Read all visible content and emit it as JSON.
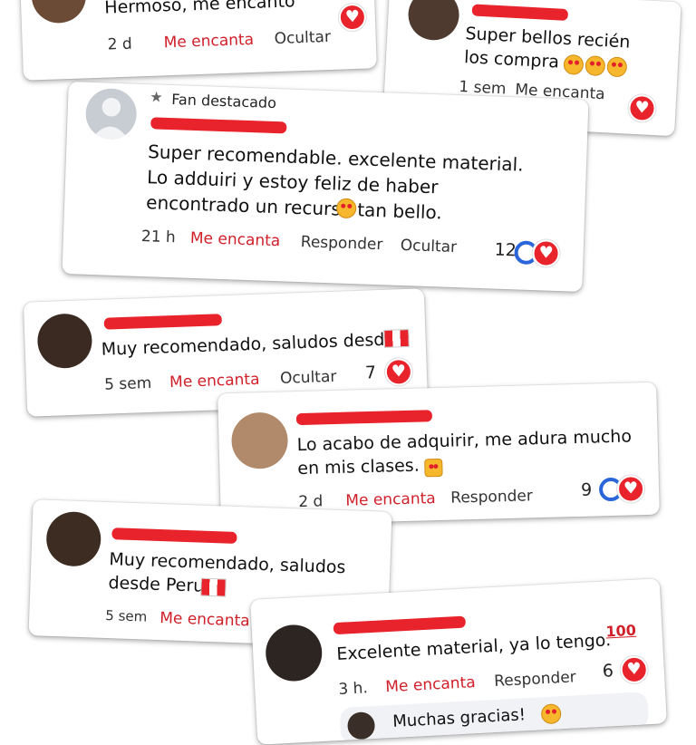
{
  "comments": [
    {
      "text": "Hermoso, me encanto",
      "time": "2 d",
      "love": "Me encanta",
      "hide": "Ocultar"
    },
    {
      "text": "Super bellos recién los compra",
      "time": "1 sem",
      "love": "Me encanta"
    },
    {
      "badge": "Fan destacado",
      "text": "Super recomendable. excelente material. Lo adduiri y estoy feliz de haber encontrado un recurso tan bello.",
      "time": "21 h",
      "love": "Me encanta",
      "reply": "Responder",
      "hide": "Ocultar",
      "count": "12"
    },
    {
      "text": "Muy recomendado, saludos desde",
      "time": "5 sem",
      "love": "Me encanta",
      "hide": "Ocultar",
      "count": "7"
    },
    {
      "text": "Lo acabo de adquirir, me adura mucho en mis clases.",
      "time": "2 d",
      "love": "Me encanta",
      "reply": "Responder",
      "count": "9"
    },
    {
      "text": "Muy recomendado, saludos desde Peru",
      "time": "5 sem",
      "love": "Me encanta"
    },
    {
      "text": "Excelente material, ya lo tengo.",
      "hundred": "100",
      "time": "3 h.",
      "love": "Me encanta",
      "reply": "Responder",
      "count": "6",
      "reply_preview": "Muchas gracias!"
    }
  ],
  "colors": {
    "redaction": "#e8232b",
    "love_text": "#d0202a",
    "like_blue": "#2a66d9"
  },
  "icons": [
    "star-icon",
    "heart-reaction-icon",
    "like-reaction-icon",
    "peru-flag-icon",
    "heart-eyes-emoji-icon",
    "pointing-hand-emoji-icon",
    "hundred-emoji-icon",
    "smile-emoji-icon",
    "default-avatar-icon"
  ]
}
